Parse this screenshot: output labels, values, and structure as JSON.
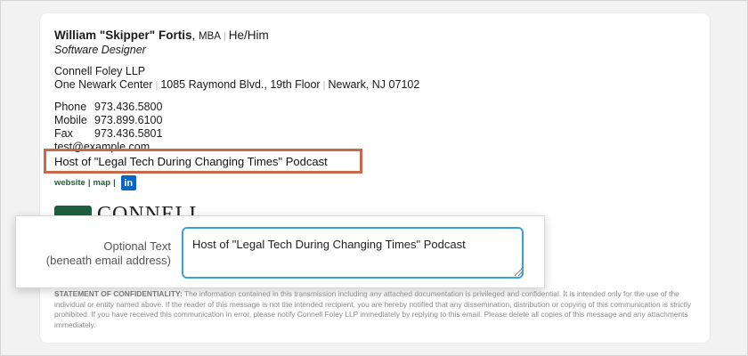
{
  "signature": {
    "name": "William \"Skipper\" Fortis",
    "credentials": "MBA",
    "pronouns": "He/Him",
    "title": "Software Designer",
    "company": "Connell Foley LLP",
    "address_1": "One Newark Center",
    "address_2": "1085 Raymond Blvd., 19th Floor",
    "address_3": "Newark, NJ 07102",
    "phone_label": "Phone",
    "phone": "973.436.5800",
    "mobile_label": "Mobile",
    "mobile": "973.899.6100",
    "fax_label": "Fax",
    "fax": "973.436.5801",
    "email": "test@example.com",
    "optional_text": "Host of \"Legal Tech During Changing Times\" Podcast",
    "links": {
      "website": "website",
      "map": "map",
      "separator": "|",
      "linkedin_icon": "in"
    },
    "logo_text": "CONNELL"
  },
  "editor": {
    "label_line1": "Optional Text",
    "label_line2": "(beneath email address)",
    "value": "Host of \"Legal Tech During Changing Times\" Podcast"
  },
  "confidentiality": {
    "heading": "STATEMENT OF CONFIDENTIALITY:",
    "body": "The information contained in this transmission including any attached documentation is privileged and confidential. It is intended only for the use of the individual or entity named above. If the reader of this message is not the intended recipient, you are hereby notified that any dissemination, distribution or copying of this communication is strictly prohibited. If you have received this communication in error, please notify Connell Foley LLP immediately by replying to this email. Please delete all copies of this message and any attachments immediately."
  },
  "colors": {
    "highlight_border": "#c9694a",
    "brand_green": "#1f5f3e",
    "input_focus": "#3aa0e0",
    "linkedin": "#0a66c2"
  }
}
